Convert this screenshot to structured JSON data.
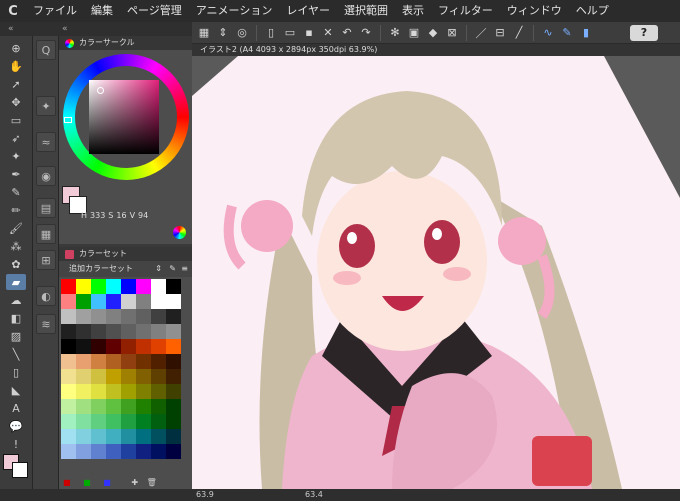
{
  "menubar": {
    "logo": "C",
    "items": [
      "ファイル",
      "編集",
      "ページ管理",
      "アニメーション",
      "レイヤー",
      "選択範囲",
      "表示",
      "フィルター",
      "ウィンドウ",
      "ヘルプ"
    ]
  },
  "toolbar": {
    "help_label": "?"
  },
  "document": {
    "tab_title": "イラスト2 (A4 4093 x 2894px 350dpi 63.9%)"
  },
  "color_circle_panel": {
    "title": "カラーサークル",
    "hsv": {
      "h": "333",
      "s": "16",
      "v": "94"
    },
    "colors": {
      "current": "#f2cbd9",
      "ring_marker": "#e0207a"
    }
  },
  "color_set_panel": {
    "title": "カラーセット",
    "set_name": "追加カラーセット",
    "swatches": [
      "#ff0000",
      "#ffff00",
      "#00ff00",
      "#00ffff",
      "#0000ff",
      "#ff00ff",
      "#ffffff",
      "#000000",
      "#ff8080",
      "#00a000",
      "#40c0ff",
      "#2020ff",
      "#d0d0d0",
      "#808080",
      "#ffffff",
      "#ffffff",
      "#c0c0c0",
      "#a0a0a0",
      "#909090",
      "#808080",
      "#707070",
      "#606060",
      "#404040",
      "#202020",
      "#202020",
      "#303030",
      "#404040",
      "#505050",
      "#606060",
      "#707070",
      "#808080",
      "#909090",
      "#000000",
      "#101010",
      "#300000",
      "#600000",
      "#902000",
      "#c03000",
      "#e04000",
      "#ff6000",
      "#f0c090",
      "#e8a070",
      "#d08040",
      "#b06020",
      "#904010",
      "#703000",
      "#502000",
      "#301000",
      "#f0e090",
      "#e0d070",
      "#d0c040",
      "#c0a000",
      "#a08000",
      "#806000",
      "#604000",
      "#402000",
      "#ffff80",
      "#f0f060",
      "#e0e040",
      "#c0c020",
      "#a0a000",
      "#808000",
      "#606000",
      "#404000",
      "#c0f0a0",
      "#a0e080",
      "#80d060",
      "#60c040",
      "#40a020",
      "#208000",
      "#106000",
      "#004000",
      "#a0f0c0",
      "#80e0a0",
      "#60d080",
      "#40c060",
      "#20a040",
      "#008020",
      "#006010",
      "#004000",
      "#a0e0f0",
      "#80d0e0",
      "#60c0d0",
      "#40b0c0",
      "#2090a0",
      "#007080",
      "#005060",
      "#003040",
      "#a0c0f0",
      "#80a0e0",
      "#6080d0",
      "#4060c0",
      "#2040a0",
      "#102080",
      "#001060",
      "#000040"
    ]
  },
  "status": {
    "zoom_left": "63.9",
    "zoom_right": "63.4"
  }
}
